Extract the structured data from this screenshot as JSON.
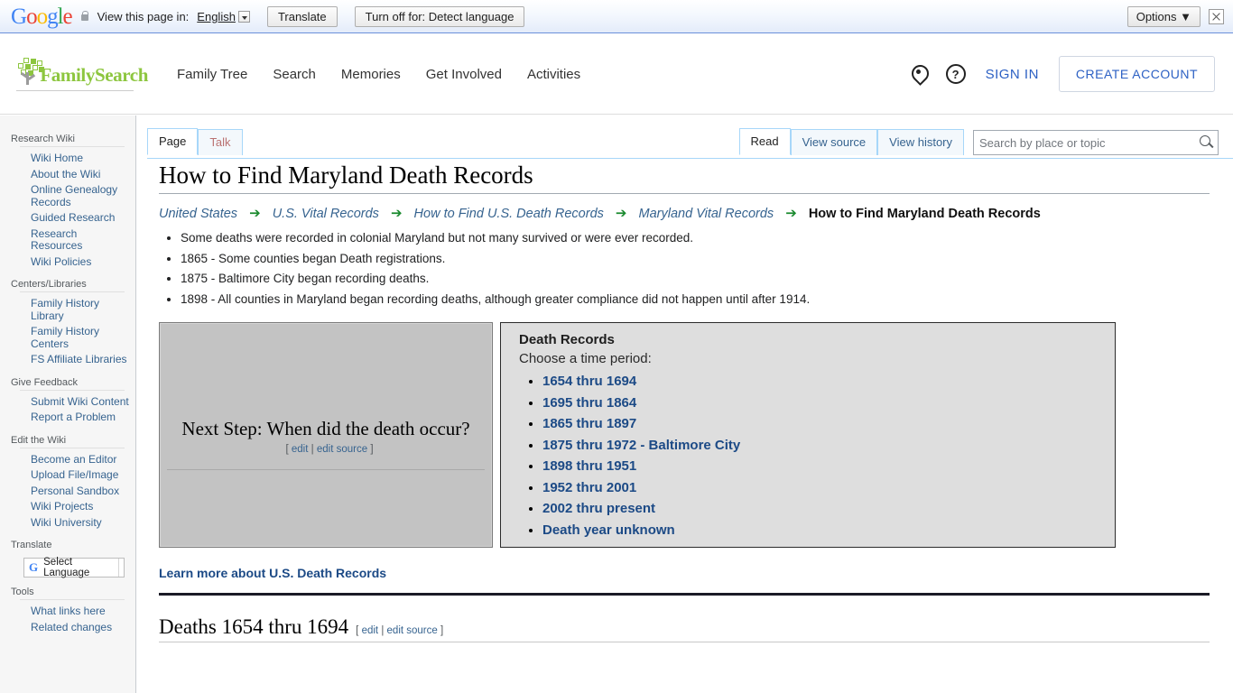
{
  "translate_bar": {
    "logo_text": "Google",
    "logo_letters": [
      "G",
      "o",
      "o",
      "g",
      "l",
      "e"
    ],
    "lock_icon": "lock-icon",
    "label": "View this page in:",
    "language": "English",
    "translate_button": "Translate",
    "turn_off_button": "Turn off for: Detect language",
    "options_button": "Options ▼",
    "close_icon": "close-icon"
  },
  "header": {
    "brand": "FamilySearch",
    "logo_icon": "familysearch-tree-logo",
    "nav": [
      {
        "label": "Family Tree"
      },
      {
        "label": "Search"
      },
      {
        "label": "Memories"
      },
      {
        "label": "Get Involved"
      },
      {
        "label": "Activities"
      }
    ],
    "location_icon": "map-pin-icon",
    "help_icon": "help-question-icon",
    "help_glyph": "?",
    "sign_in": "SIGN IN",
    "create_account": "CREATE ACCOUNT",
    "accent_color": "#8dc63f",
    "link_color": "#2d61c4"
  },
  "sidebar": {
    "sections": [
      {
        "heading": "Research Wiki",
        "items": [
          "Wiki Home",
          "About the Wiki",
          "Online Genealogy Records",
          "Guided Research",
          "Research Resources",
          "Wiki Policies"
        ]
      },
      {
        "heading": "Centers/Libraries",
        "items": [
          "Family History Library",
          "Family History Centers",
          "FS Affiliate Libraries"
        ]
      },
      {
        "heading": "Give Feedback",
        "items": [
          "Submit Wiki Content",
          "Report a Problem"
        ]
      },
      {
        "heading": "Edit the Wiki",
        "items": [
          "Become an Editor",
          "Upload File/Image",
          "Personal Sandbox",
          "Wiki Projects",
          "Wiki University"
        ]
      }
    ],
    "translate_heading": "Translate",
    "translate_widget": {
      "icon": "google-g-icon",
      "glyph": "G",
      "label": "Select Language"
    },
    "tools_heading": "Tools",
    "tools_items": [
      "What links here",
      "Related changes"
    ]
  },
  "tabs": {
    "left": [
      {
        "label": "Page",
        "state": "selected"
      },
      {
        "label": "Talk",
        "state": "newpage"
      }
    ],
    "right": [
      {
        "label": "Read",
        "state": "selected"
      },
      {
        "label": "View source",
        "state": "plain"
      },
      {
        "label": "View history",
        "state": "plain"
      }
    ]
  },
  "search": {
    "placeholder": "Search by place or topic",
    "value": "",
    "icon": "search-magnifier-icon"
  },
  "article": {
    "title": "How to Find Maryland Death Records",
    "breadcrumb": {
      "arrow": "➔",
      "links": [
        "United States",
        "U.S. Vital Records",
        "How to Find U.S. Death Records",
        "Maryland Vital Records"
      ],
      "current": "How to Find Maryland Death Records"
    },
    "intro_bullets": [
      "Some deaths were recorded in colonial Maryland but not many survived or were ever recorded.",
      "1865 - Some counties began Death registrations.",
      "1875 - Baltimore City began recording deaths.",
      "1898 - All counties in Maryland began recording deaths, although greater compliance did not happen until after 1914."
    ],
    "next_step": {
      "title": "Next Step: When did the death occur?",
      "edit_open": "[",
      "edit": "edit",
      "edit_sep": "|",
      "edit_source": "edit source",
      "edit_close": "]"
    },
    "death_records_panel": {
      "title": "Death Records",
      "subtitle": "Choose a time period:",
      "links": [
        "1654 thru 1694",
        "1695 thru 1864",
        "1865 thru 1897",
        "1875 thru 1972 - Baltimore City",
        "1898 thru 1951",
        "1952 thru 2001",
        "2002 thru present",
        "Death year unknown"
      ],
      "link_color": "#1c4a86"
    },
    "learn_more": "Learn more about U.S. Death Records",
    "section": {
      "title": "Deaths 1654 thru 1694",
      "edit_open": "[",
      "edit": "edit",
      "edit_sep": "|",
      "edit_source": "edit source",
      "edit_close": "]"
    }
  }
}
